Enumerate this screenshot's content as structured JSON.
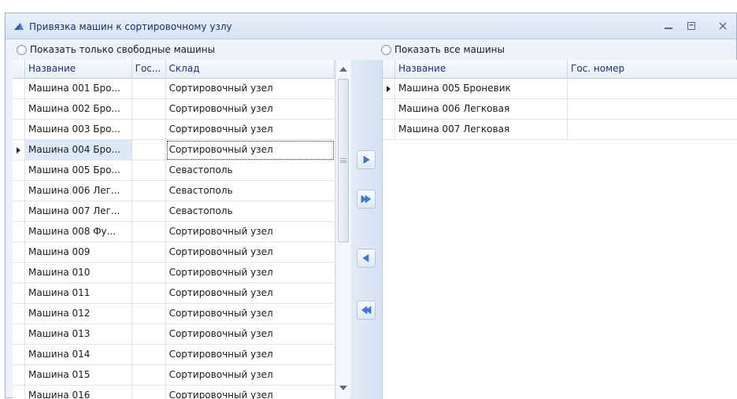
{
  "window": {
    "title": "Привязка машин к сортировочному узлу"
  },
  "filters": {
    "left_option": "Показать только свободные машины",
    "right_option": "Показать все машины"
  },
  "left_grid": {
    "columns": [
      "Название",
      "Гос...",
      "Склад"
    ],
    "rows": [
      {
        "name": "Машина 001 Бро...",
        "plate": "",
        "warehouse": "Сортировочный узел"
      },
      {
        "name": "Машина 002 Бро...",
        "plate": "",
        "warehouse": "Сортировочный узел"
      },
      {
        "name": "Машина 003 Бро...",
        "plate": "",
        "warehouse": "Сортировочный узел"
      },
      {
        "name": "Машина 004 Бро...",
        "plate": "",
        "warehouse": "Сортировочный узел"
      },
      {
        "name": "Машина 005 Бро...",
        "plate": "",
        "warehouse": "Севастополь"
      },
      {
        "name": "Машина 006 Лег...",
        "plate": "",
        "warehouse": "Севастополь"
      },
      {
        "name": "Машина 007 Лег...",
        "plate": "",
        "warehouse": "Севастополь"
      },
      {
        "name": "Машина 008 Фу...",
        "plate": "",
        "warehouse": "Сортировочный узел"
      },
      {
        "name": "Машина 009",
        "plate": "",
        "warehouse": "Сортировочный узел"
      },
      {
        "name": "Машина 010",
        "plate": "",
        "warehouse": "Сортировочный узел"
      },
      {
        "name": "Машина 011",
        "plate": "",
        "warehouse": "Сортировочный узел"
      },
      {
        "name": "Машина 012",
        "plate": "",
        "warehouse": "Сортировочный узел"
      },
      {
        "name": "Машина 013",
        "plate": "",
        "warehouse": "Сортировочный узел"
      },
      {
        "name": "Машина 014",
        "plate": "",
        "warehouse": "Сортировочный узел"
      },
      {
        "name": "Машина 015",
        "plate": "",
        "warehouse": "Сортировочный узел"
      },
      {
        "name": "Машина 016",
        "plate": "",
        "warehouse": "Сортировочный узел"
      }
    ],
    "current_row": 3
  },
  "right_grid": {
    "columns": [
      "Название",
      "Гос. номер"
    ],
    "rows": [
      {
        "name": "Машина 005 Броневик",
        "plate": ""
      },
      {
        "name": "Машина 006 Легковая",
        "plate": ""
      },
      {
        "name": "Машина 007 Легковая",
        "plate": ""
      }
    ],
    "current_row": 0
  },
  "transfer_buttons": {
    "move_one_right_icon": "triangle-right-icon",
    "move_all_right_icon": "double-triangle-right-icon",
    "move_one_left_icon": "triangle-left-icon",
    "move_all_left_icon": "double-triangle-left-icon"
  },
  "colors": {
    "accent": "#2f63c9",
    "header_text": "#163572",
    "selection": "#dde9f8"
  }
}
